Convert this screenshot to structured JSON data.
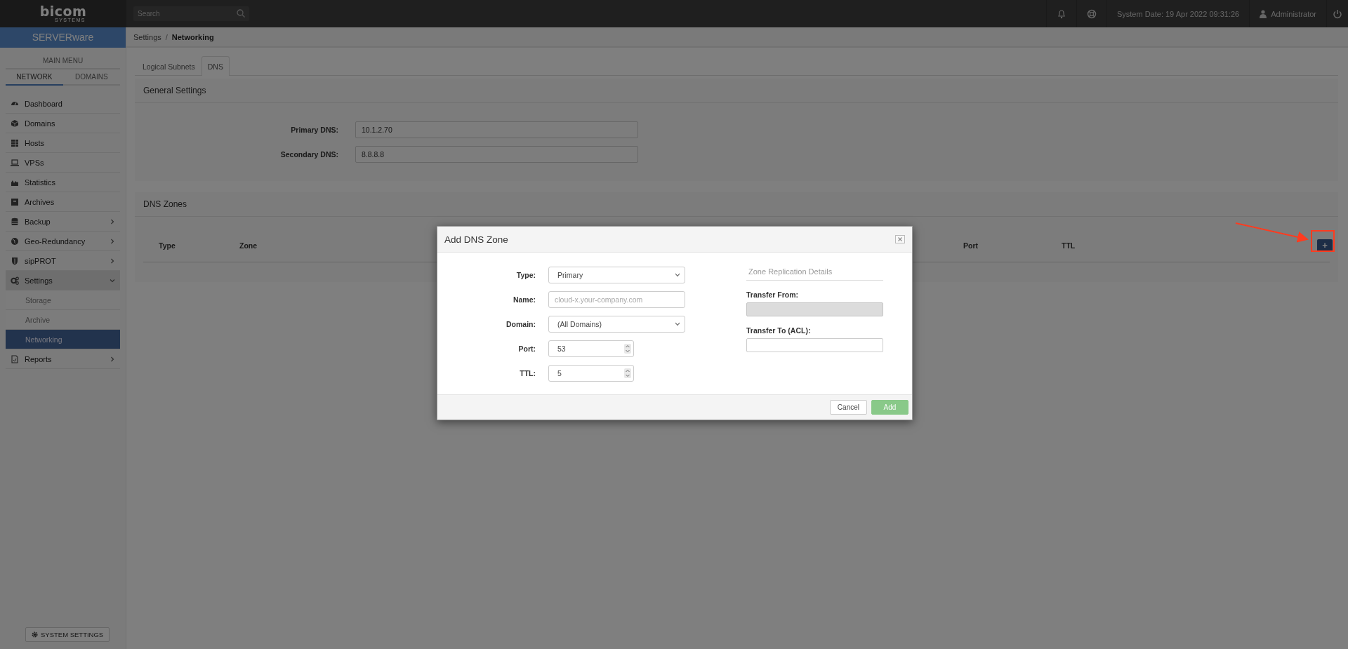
{
  "topbar": {
    "logo": {
      "name": "bicom",
      "tagline": "SYSTEMS"
    },
    "search": {
      "placeholder": "Search"
    },
    "system_date": "System Date: 19 Apr 2022 09:31:26",
    "user": "Administrator"
  },
  "sidebar": {
    "product": "SERVERware",
    "menu_title": "MAIN MENU",
    "tabs": [
      {
        "label": "NETWORK",
        "selected": true
      },
      {
        "label": "DOMAINS",
        "selected": false
      }
    ],
    "items": [
      {
        "label": "Dashboard",
        "selected": false
      },
      {
        "label": "Domains",
        "selected": false
      },
      {
        "label": "Hosts",
        "selected": false
      },
      {
        "label": "VPSs",
        "selected": false
      },
      {
        "label": "Statistics",
        "selected": false
      },
      {
        "label": "Archives",
        "selected": false
      },
      {
        "label": "Backup",
        "selected": false,
        "expanded": false
      },
      {
        "label": "Geo-Redundancy",
        "selected": false,
        "expanded": false
      },
      {
        "label": "sipPROT",
        "selected": false,
        "expanded": false
      },
      {
        "label": "Settings",
        "selected": false,
        "expanded": true,
        "children": [
          {
            "label": "Storage",
            "selected": false
          },
          {
            "label": "Archive",
            "selected": false
          },
          {
            "label": "Networking",
            "selected": true
          }
        ]
      },
      {
        "label": "Reports",
        "selected": false,
        "expanded": false
      }
    ],
    "system_settings_button": "SYSTEM SETTINGS"
  },
  "breadcrumb": [
    "Settings",
    "Networking"
  ],
  "breadcrumb_separator": "/",
  "tabs": [
    {
      "label": "Logical Subnets",
      "selected": false
    },
    {
      "label": "DNS",
      "selected": true
    }
  ],
  "general_settings": {
    "title": "General Settings",
    "fields": [
      {
        "label": "Primary DNS:",
        "value": "10.1.2.70"
      },
      {
        "label": "Secondary DNS:",
        "value": "8.8.8.8"
      }
    ]
  },
  "dns_zones": {
    "title": "DNS Zones",
    "columns": [
      "Type",
      "Zone",
      "Port",
      "TTL"
    ],
    "add_button": "+"
  },
  "modal": {
    "title": "Add DNS Zone",
    "fields": [
      {
        "label": "Type:",
        "kind": "select",
        "value": "Primary"
      },
      {
        "label": "Name:",
        "kind": "text",
        "placeholder": "cloud-x.your-company.com"
      },
      {
        "label": "Domain:",
        "kind": "select",
        "value": "(All Domains)"
      },
      {
        "label": "Port:",
        "kind": "number",
        "value": "53"
      },
      {
        "label": "TTL:",
        "kind": "number",
        "value": "5"
      }
    ],
    "replication": {
      "title": "Zone Replication Details",
      "fields": [
        {
          "label": "Transfer From:",
          "disabled": true
        },
        {
          "label": "Transfer To (ACL):",
          "disabled": false
        }
      ]
    },
    "buttons": [
      {
        "label": "Cancel",
        "kind": "secondary",
        "disabled": false
      },
      {
        "label": "Add",
        "kind": "primary",
        "disabled": true
      }
    ]
  }
}
